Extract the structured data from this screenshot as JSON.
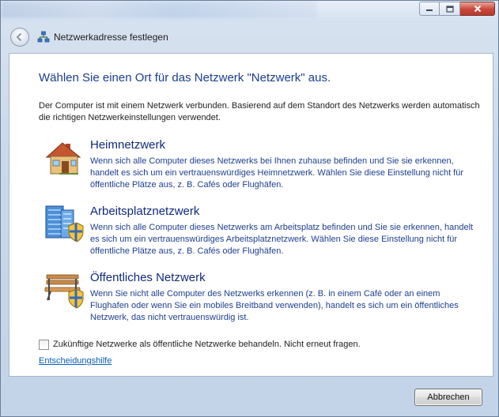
{
  "window": {
    "nav_title": "Netzwerkadresse festlegen",
    "caption": {
      "minimize_icon": "minimize-icon",
      "maximize_icon": "maximize-icon",
      "close_icon": "close-icon"
    }
  },
  "main": {
    "heading": "Wählen Sie einen Ort für das Netzwerk \"Netzwerk\" aus.",
    "intro": "Der Computer ist mit einem Netzwerk verbunden. Basierend auf dem Standort des Netzwerks werden automatisch die richtigen Netzwerkeinstellungen verwendet.",
    "options": [
      {
        "icon": "house-icon",
        "title": "Heimnetzwerk",
        "description": "Wenn sich alle Computer dieses Netzwerks bei Ihnen zuhause befinden und Sie sie erkennen, handelt es sich um ein vertrauenswürdiges Heimnetzwerk. Wählen Sie diese Einstellung nicht für öffentliche Plätze aus, z. B. Cafés oder Flughäfen."
      },
      {
        "icon": "office-building-icon",
        "title": "Arbeitsplatznetzwerk",
        "description": "Wenn sich alle Computer dieses Netzwerks am Arbeitsplatz befinden und Sie sie erkennen, handelt es sich um ein vertrauenswürdiges Arbeitsplatznetzwerk. Wählen Sie diese Einstellung nicht für öffentliche Plätze aus, z. B. Cafés oder Flughäfen."
      },
      {
        "icon": "park-bench-icon",
        "title": "Öffentliches Netzwerk",
        "description": "Wenn Sie nicht alle Computer des Netzwerks erkennen (z. B. in einem Café oder an einem Flughafen oder wenn Sie ein mobiles Breitband verwenden), handelt es sich um ein öffentliches Netzwerk, das nicht vertrauenswürdig ist."
      }
    ],
    "checkbox_label": "Zukünftige Netzwerke als öffentliche Netzwerke behandeln. Nicht erneut fragen.",
    "checkbox_checked": false,
    "help_link": "Entscheidungshilfe"
  },
  "footer": {
    "cancel_label": "Abbrechen"
  },
  "colors": {
    "heading": "#1a3e8c",
    "option_title": "#0f2a7a",
    "option_text": "#1e3f8f",
    "link": "#0b5fb5"
  }
}
